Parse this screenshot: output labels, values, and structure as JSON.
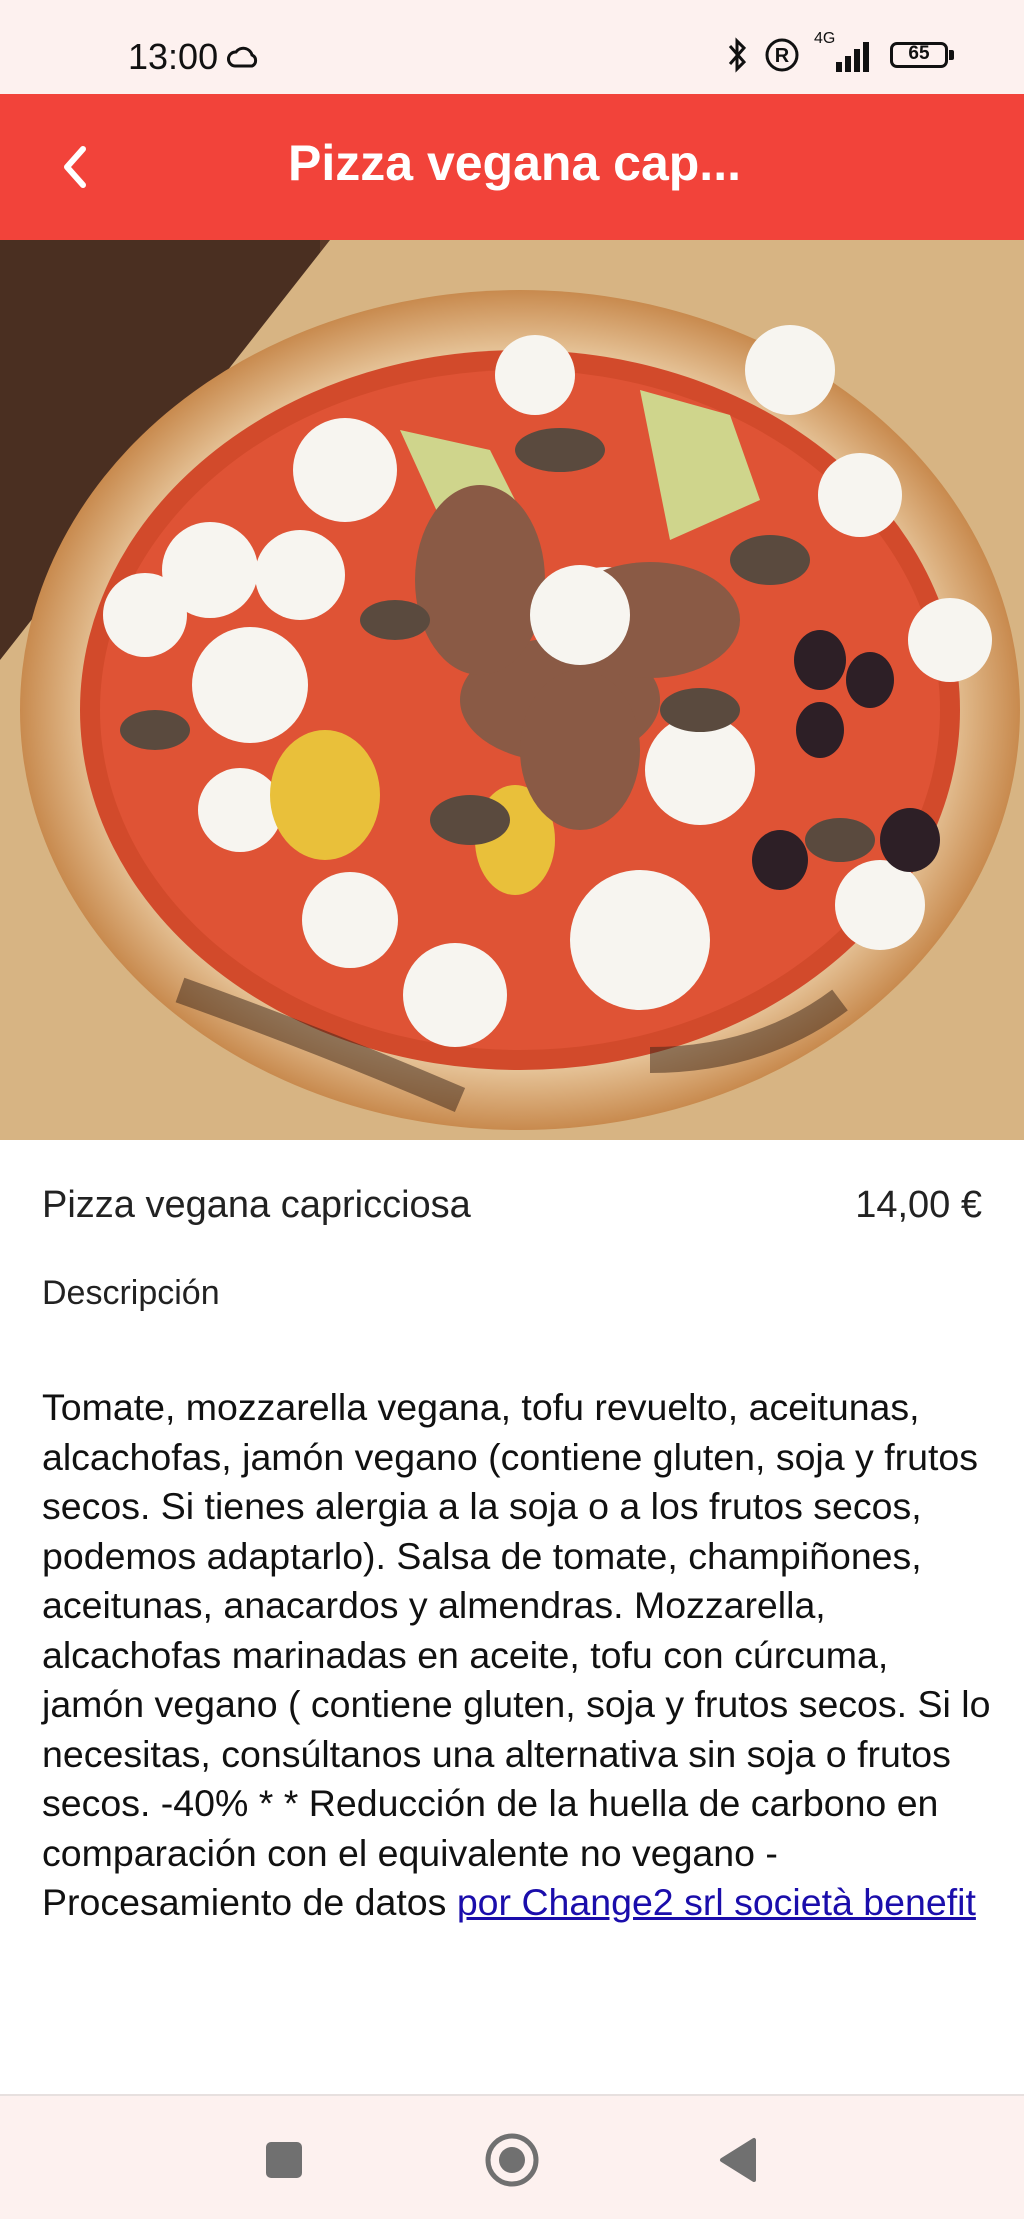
{
  "status_bar": {
    "time": "13:00",
    "network": "4G",
    "battery": "65"
  },
  "app_bar": {
    "title": "Pizza vegana cap..."
  },
  "product": {
    "name": "Pizza vegana capricciosa",
    "price": "14,00 €",
    "description_label": "Descripción",
    "description": "Tomate, mozzarella vegana, tofu revuelto, aceitunas, alcachofas, jamón vegano  (contiene gluten, soja y frutos secos. Si tienes alergia a la soja o a los frutos secos, podemos adaptarlo). Salsa de tomate, champiñones, aceitunas, anacardos y almendras. Mozzarella, alcachofas marinadas en aceite, tofu con cúrcuma, jamón vegano ( contiene gluten, soja y frutos secos. Si lo necesitas, consúltanos una alternativa sin soja o frutos secos.  -40% * *  Reducción de la huella de carbono en comparación con el equivalente no vegano - Procesamiento de datos ",
    "description_link": "por Change2 srl società benefit"
  },
  "colors": {
    "accent": "#f2433a",
    "status_bg": "#fdf1ef",
    "link": "#1a0dab"
  },
  "icons": {
    "back": "chevron-left-icon",
    "home": "circle-home-icon",
    "recents": "square-recents-icon",
    "nav_back": "triangle-back-icon"
  }
}
